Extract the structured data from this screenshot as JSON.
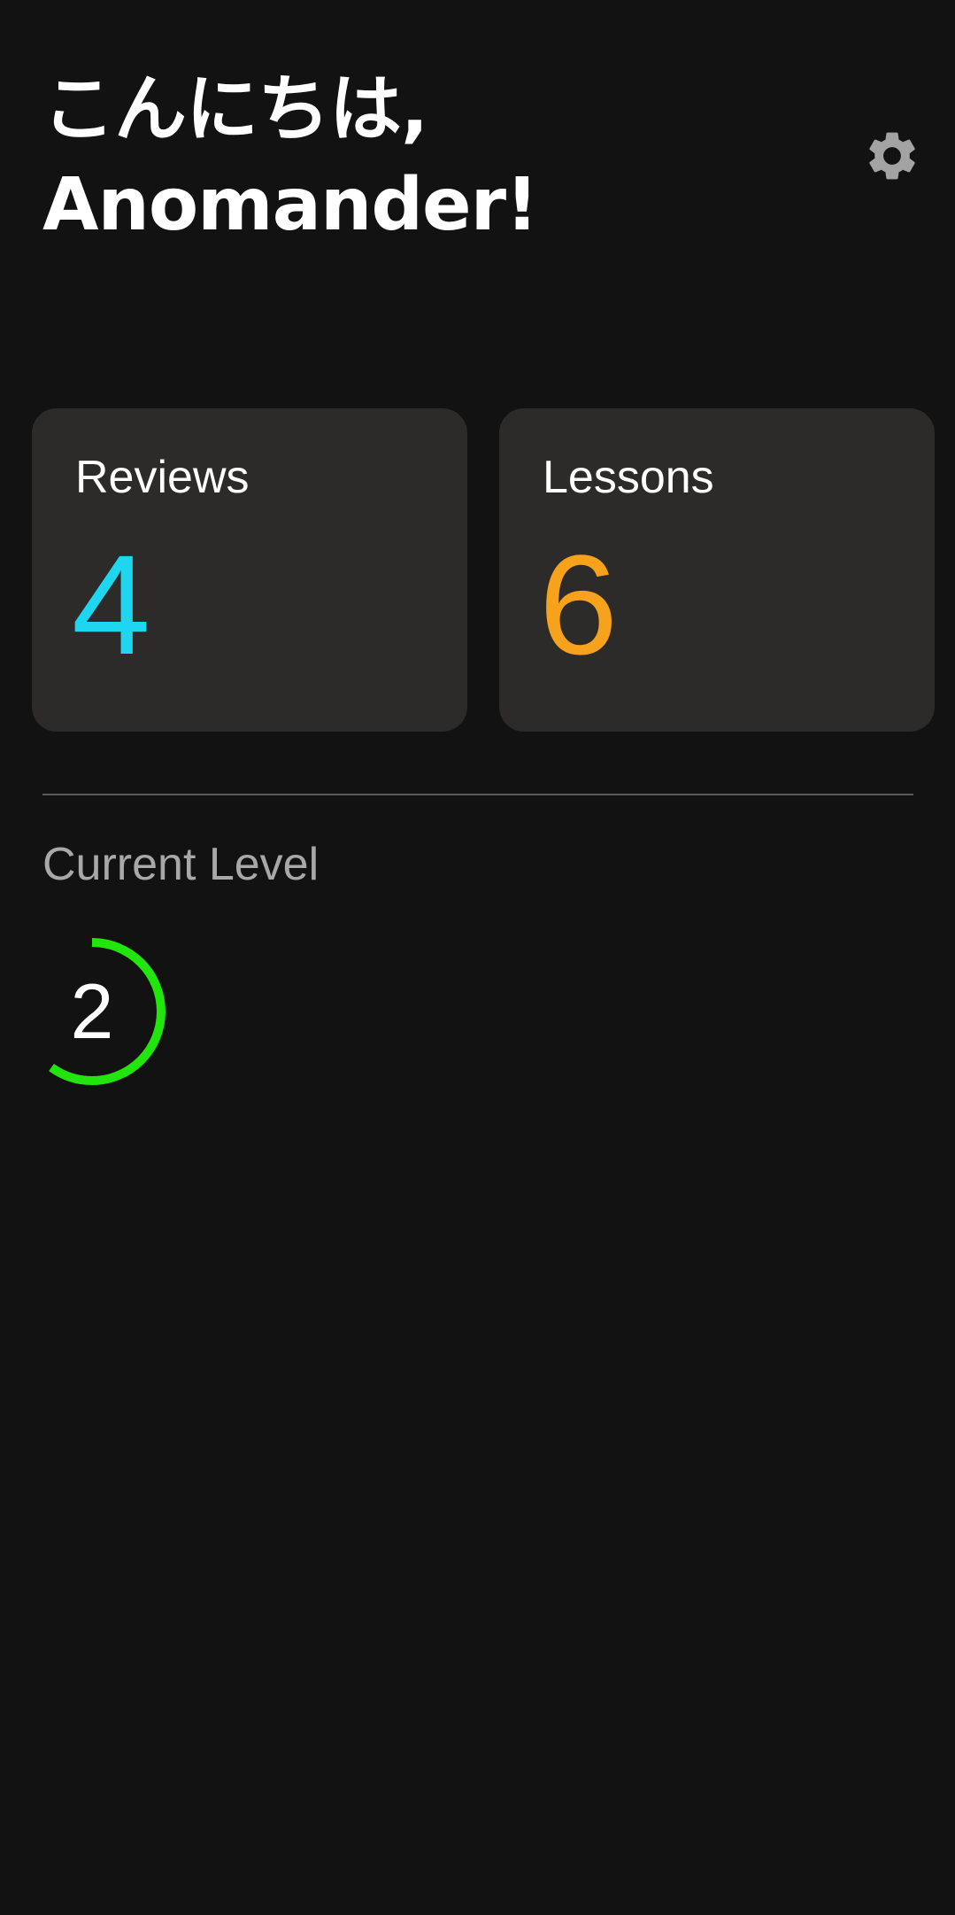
{
  "header": {
    "greeting_line1": "こんにちは,",
    "greeting_line2": "Anomander!",
    "settings_icon": "gear-icon"
  },
  "summary": {
    "reviews": {
      "label": "Reviews",
      "count": "4",
      "color": "#1ed6f0"
    },
    "lessons": {
      "label": "Lessons",
      "count": "6",
      "color": "#f6a21d"
    }
  },
  "level": {
    "heading": "Current Level",
    "value": "2",
    "progress": 0.6,
    "ring_color": "#22e50e"
  },
  "colors": {
    "background": "#121212",
    "card": "#2c2b2a",
    "icon": "#a3a3a3"
  }
}
